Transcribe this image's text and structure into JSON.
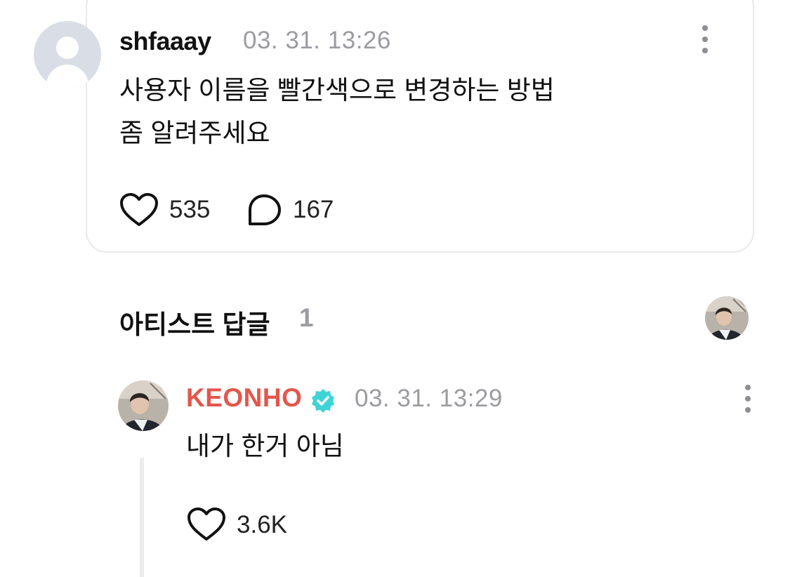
{
  "post": {
    "username": "shfaaay",
    "timestamp": "03. 31. 13:26",
    "text_line1": "사용자 이름을 빨간색으로 변경하는 방법",
    "text_line2": "좀 알려주세요",
    "likes": "535",
    "comments": "167",
    "menu_icon": "more-vertical-icon"
  },
  "artist_section": {
    "title": "아티스트 답글",
    "count": "1"
  },
  "reply": {
    "name": "KEONHO",
    "name_color": "#e2574c",
    "verified_icon": "verified-badge-icon",
    "verified_color": "#3fd3d8",
    "timestamp": "03. 31. 13:29",
    "text": "내가 한거 아님",
    "likes": "3.6K",
    "menu_icon": "more-vertical-icon"
  },
  "colors": {
    "muted": "#9b9ba1",
    "card_border": "#e9e9ec"
  }
}
